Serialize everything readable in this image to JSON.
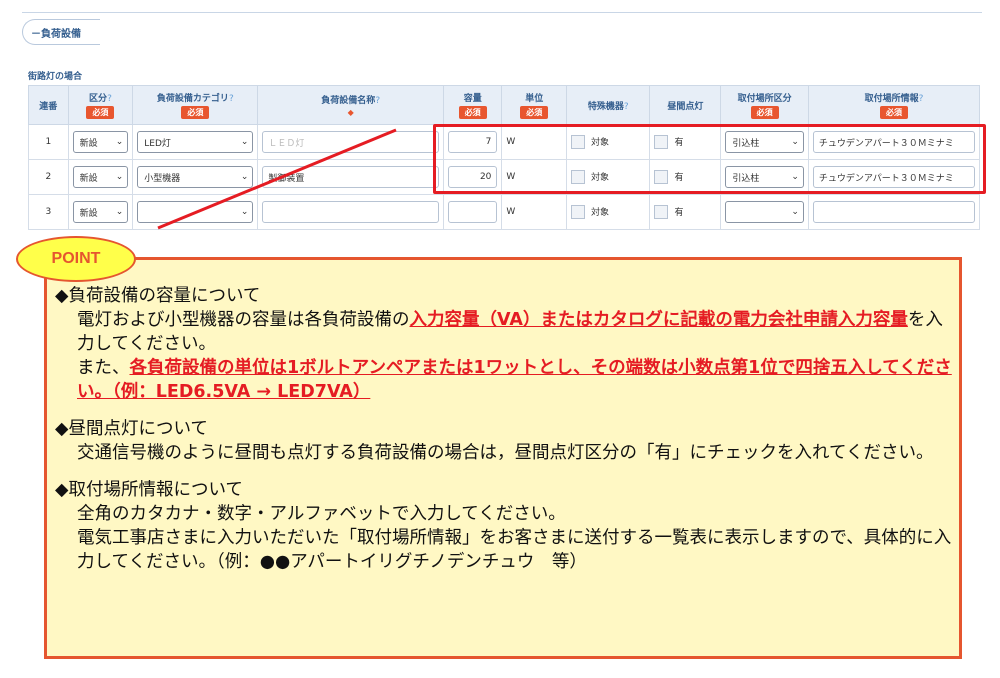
{
  "section": {
    "title": "負荷設備"
  },
  "subtitle": "街路灯の場合",
  "table": {
    "headers": {
      "seq": "連番",
      "kubun": "区分",
      "category": "負荷設備カテゴリ",
      "name": "負荷設備名称",
      "capacity": "容量",
      "unit": "単位",
      "special": "特殊機器",
      "daylight": "昼間点灯",
      "mount_type": "取付場所区分",
      "mount_info": "取付場所情報",
      "required": "必須"
    },
    "rows": [
      {
        "seq": "1",
        "kubun": "新設",
        "category": "LED灯",
        "name": "ＬＥＤ灯",
        "capacity": "7",
        "unit": "W",
        "special": "対象",
        "daylight": "有",
        "mount_type": "引込柱",
        "mount_info": "チュウデンアパート３０Ｍミナミ"
      },
      {
        "seq": "2",
        "kubun": "新設",
        "category": "小型機器",
        "name": "製御装置",
        "capacity": "20",
        "unit": "W",
        "special": "対象",
        "daylight": "有",
        "mount_type": "引込柱",
        "mount_info": "チュウデンアパート３０Ｍミナミ"
      },
      {
        "seq": "3",
        "kubun": "新設",
        "category": "",
        "name": "",
        "capacity": "",
        "unit": "W",
        "special": "対象",
        "daylight": "有",
        "mount_type": "",
        "mount_info": ""
      }
    ]
  },
  "point": {
    "badge": "POINT",
    "s1_title": "◆負荷設備の容量について",
    "s1_a": "電灯および小型機器の容量は各負荷設備の",
    "s1_red1": "入力容量（VA）またはカタログに記載の電力会社申請入力容量",
    "s1_b": "を入力してください。",
    "s1_c": "また、",
    "s1_red2": "各負荷設備の単位は1ボルトアンペアまたは1ワットとし、その端数は小数点第1位で四捨五入してください。（例：LED6.5VA → LED7VA）",
    "s2_title": "◆昼間点灯について",
    "s2_body": "交通信号機のように昼間も点灯する負荷設備の場合は，昼間点灯区分の「有」にチェックを入れてください。",
    "s3_title": "◆取付場所情報について",
    "s3_body1": "全角のカタカナ・数字・アルファベットで入力してください。",
    "s3_body2": "電気工事店さまに入力いただいた「取付場所情報」をお客さまに送付する一覧表に表示しますので、具体的に入力してください。（例：●●アパートイリグチノデンチュウ　等）"
  },
  "colors": {
    "accent": "#e5562f",
    "highlight": "#e51c23",
    "panel_bg": "#fff8c4",
    "header_bg": "#e7eef7"
  }
}
